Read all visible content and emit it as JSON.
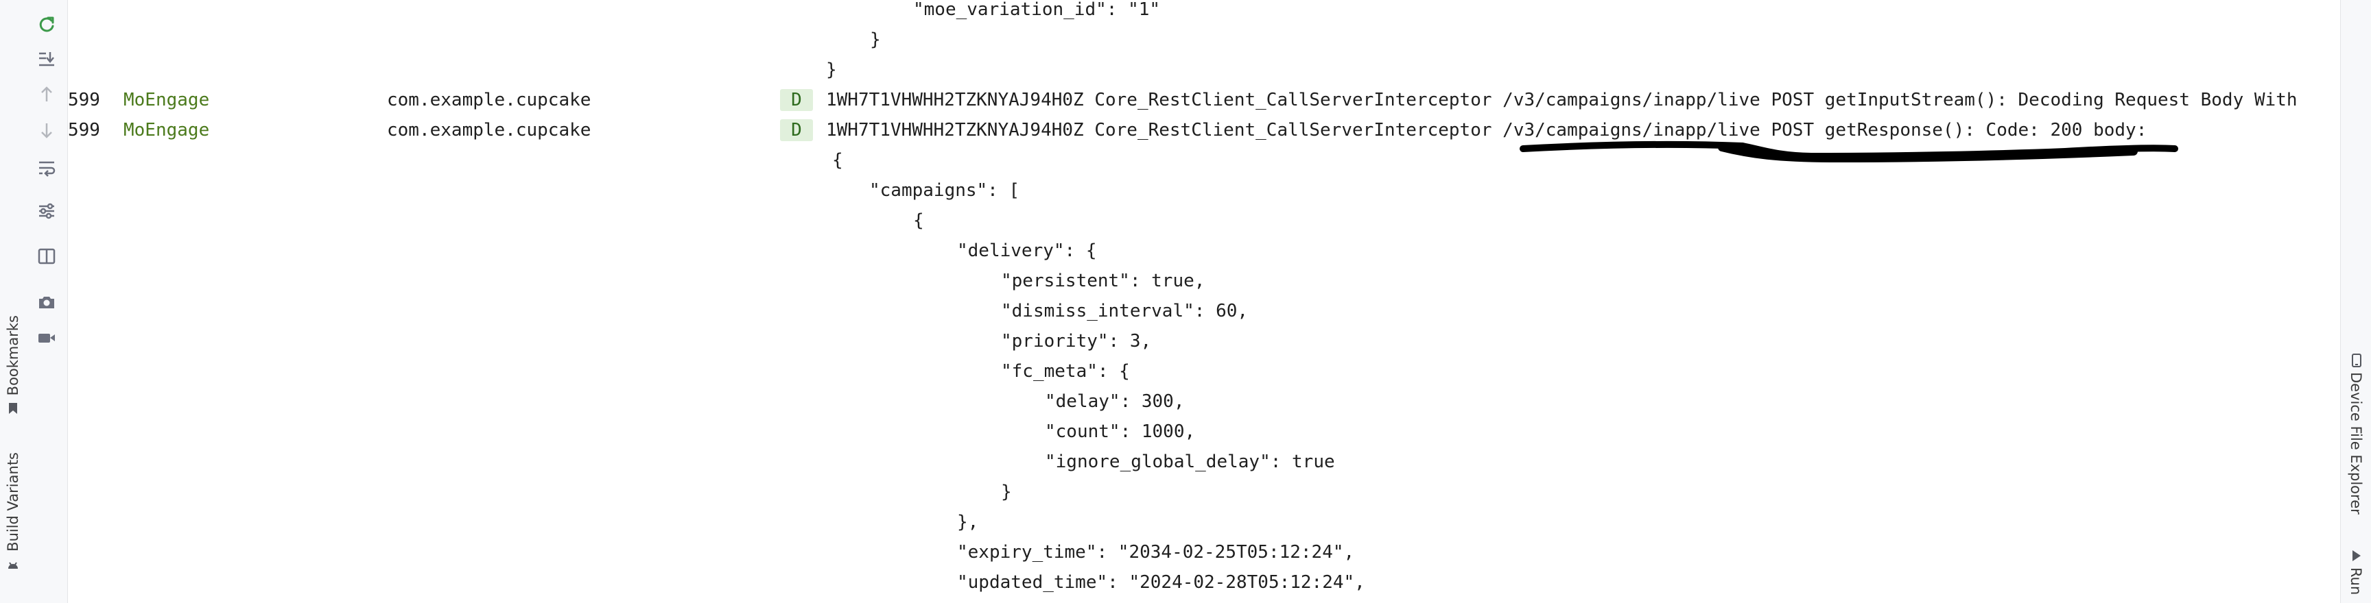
{
  "left_stripe": {
    "bookmarks_label": "Bookmarks",
    "build_variants_label": "Build Variants"
  },
  "toolbar": {
    "buttons": [
      {
        "icon": "restart-icon",
        "label": "Restart logcat"
      },
      {
        "icon": "scroll-to-end-icon",
        "label": "Scroll to end"
      },
      {
        "icon": "arrow-up-icon",
        "label": "Previous occurrence"
      },
      {
        "icon": "arrow-down-icon",
        "label": "Next occurrence"
      },
      {
        "icon": "soft-wrap-icon",
        "label": "Soft-wrap"
      },
      {
        "icon": "filter-settings-icon",
        "label": "Configure logcat formatting"
      },
      {
        "icon": "split-panels-icon",
        "label": "Split panels"
      },
      {
        "icon": "camera-icon",
        "label": "Screen capture"
      },
      {
        "icon": "video-icon",
        "label": "Screen record"
      }
    ]
  },
  "right_stripe": {
    "device_file_explorer_label": "Device File Explorer",
    "run_label": "Run"
  },
  "colors": {
    "tag": "#4b7a1c",
    "level_bg": "#e1f0dc",
    "level_fg": "#2e6b1e",
    "toolbar_icon": "#6c707e",
    "restart_icon": "#3c9a4a"
  },
  "log": {
    "json_top": [
      "\"moe_variation_id\": \"1\"",
      "}",
      "}"
    ],
    "entries": [
      {
        "pid": "599",
        "tag": "MoEngage",
        "package": "com.example.cupcake",
        "level": "D",
        "message": "1WH7T1VHWHH2TZKNYAJ94H0Z Core_RestClient_CallServerInterceptor /v3/campaigns/inapp/live POST getInputStream(): Decoding Request Body With"
      },
      {
        "pid": "599",
        "tag": "MoEngage",
        "package": "com.example.cupcake",
        "level": "D",
        "message": "1WH7T1VHWHH2TZKNYAJ94H0Z Core_RestClient_CallServerInterceptor /v3/campaigns/inapp/live POST getResponse(): Code: 200 body:"
      }
    ],
    "json_body": [
      "{",
      "\"campaigns\": [",
      "{",
      "\"delivery\": {",
      "\"persistent\": true,",
      "\"dismiss_interval\": 60,",
      "\"priority\": 3,",
      "\"fc_meta\": {",
      "\"delay\": 300,",
      "\"count\": 1000,",
      "\"ignore_global_delay\": true",
      "}",
      "},",
      "\"expiry_time\": \"2034-02-25T05:12:24\",",
      "\"updated_time\": \"2024-02-28T05:12:24\","
    ]
  }
}
